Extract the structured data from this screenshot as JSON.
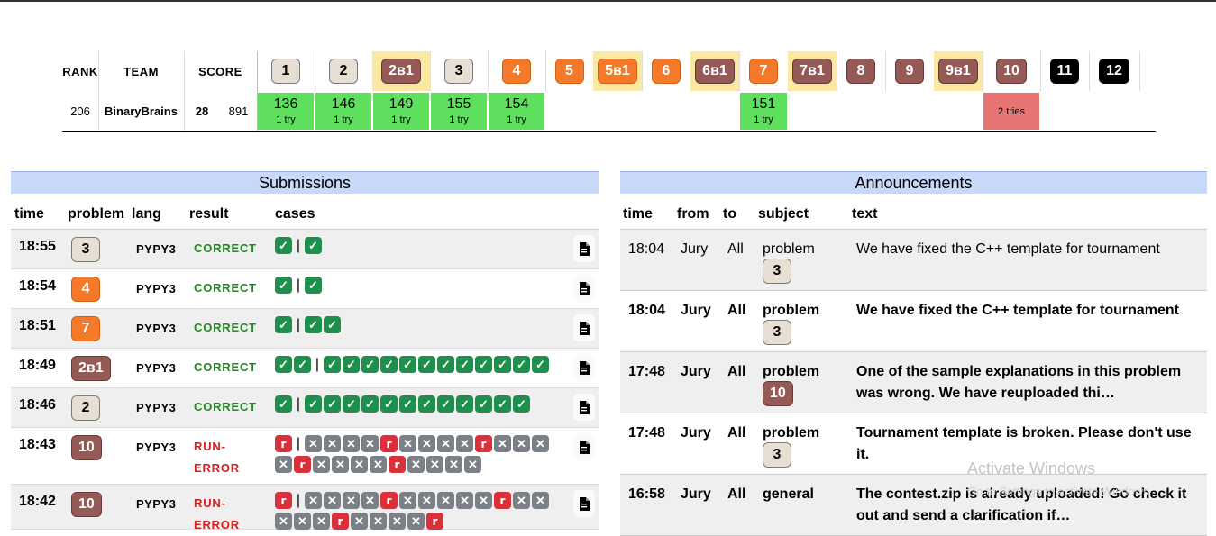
{
  "standings": {
    "headers": {
      "rank": "RANK",
      "team": "TEAM",
      "score": "SCORE"
    },
    "problems": [
      {
        "label": "1",
        "color": "tan",
        "hl": false
      },
      {
        "label": "2",
        "color": "tan",
        "hl": false
      },
      {
        "label": "2в1",
        "color": "brown",
        "hl": true
      },
      {
        "label": "3",
        "color": "tan",
        "hl": false
      },
      {
        "label": "4",
        "color": "orange",
        "hl": false
      },
      {
        "label": "5",
        "color": "orange",
        "hl": false
      },
      {
        "label": "5в1",
        "color": "orange",
        "hl": true
      },
      {
        "label": "6",
        "color": "orange",
        "hl": false
      },
      {
        "label": "6в1",
        "color": "brown",
        "hl": true
      },
      {
        "label": "7",
        "color": "orange",
        "hl": false
      },
      {
        "label": "7в1",
        "color": "brown",
        "hl": true
      },
      {
        "label": "8",
        "color": "brown",
        "hl": false
      },
      {
        "label": "9",
        "color": "brown",
        "hl": false
      },
      {
        "label": "9в1",
        "color": "brown",
        "hl": true
      },
      {
        "label": "10",
        "color": "brown",
        "hl": false
      },
      {
        "label": "11",
        "color": "black",
        "hl": false
      },
      {
        "label": "12",
        "color": "black",
        "hl": false
      }
    ],
    "row": {
      "rank": "206",
      "team": "BinaryBrains",
      "solved": "28",
      "penalty": "891",
      "cells": [
        {
          "time": "136",
          "tries": "1 try",
          "status": "ok"
        },
        {
          "time": "146",
          "tries": "1 try",
          "status": "ok"
        },
        {
          "time": "149",
          "tries": "1 try",
          "status": "ok"
        },
        {
          "time": "155",
          "tries": "1 try",
          "status": "ok"
        },
        {
          "time": "154",
          "tries": "1 try",
          "status": "ok"
        },
        null,
        null,
        null,
        null,
        {
          "time": "151",
          "tries": "1 try",
          "status": "ok"
        },
        null,
        null,
        null,
        null,
        {
          "time": "",
          "tries": "2 tries",
          "status": "bad"
        },
        null,
        null
      ]
    }
  },
  "submissions": {
    "title": "Submissions",
    "headers": {
      "time": "time",
      "problem": "problem",
      "lang": "lang",
      "result": "result",
      "cases": "cases"
    },
    "rows": [
      {
        "time": "18:55",
        "problem": "3",
        "pcolor": "tan",
        "lang": "PYPY3",
        "result": "CORRECT",
        "rtype": "correct",
        "cases": "o|o"
      },
      {
        "time": "18:54",
        "problem": "4",
        "pcolor": "orange",
        "lang": "PYPY3",
        "result": "CORRECT",
        "rtype": "correct",
        "cases": "o|o"
      },
      {
        "time": "18:51",
        "problem": "7",
        "pcolor": "orange",
        "lang": "PYPY3",
        "result": "CORRECT",
        "rtype": "correct",
        "cases": "o|oo"
      },
      {
        "time": "18:49",
        "problem": "2в1",
        "pcolor": "brown",
        "lang": "PYPY3",
        "result": "CORRECT",
        "rtype": "correct",
        "cases": "oo|oooooooooooo"
      },
      {
        "time": "18:46",
        "problem": "2",
        "pcolor": "tan",
        "lang": "PYPY3",
        "result": "CORRECT",
        "rtype": "correct",
        "cases": "o|oooooooooooo"
      },
      {
        "time": "18:43",
        "problem": "10",
        "pcolor": "brown",
        "lang": "PYPY3",
        "result": "RUN-ERROR",
        "rtype": "error",
        "cases": "r|xxxxrxxxxrxxxxrxxxxrxxxx"
      },
      {
        "time": "18:42",
        "problem": "10",
        "pcolor": "brown",
        "lang": "PYPY3",
        "result": "RUN-ERROR",
        "rtype": "error",
        "cases": "r|xxxxrxxxxxrxxxxxrxxxxr"
      }
    ],
    "icons": {
      "file": "file-icon",
      "check": "check-icon",
      "cross": "cross-icon",
      "runerror": "r"
    }
  },
  "announcements": {
    "title": "Announcements",
    "headers": {
      "time": "time",
      "from": "from",
      "to": "to",
      "subject": "subject",
      "text": "text"
    },
    "rows": [
      {
        "time": "18:04",
        "from": "Jury",
        "to": "All",
        "subject": "problem",
        "problem": "3",
        "pcolor": "tan",
        "text": "We have fixed the C++ template for tournament",
        "bold": false
      },
      {
        "time": "18:04",
        "from": "Jury",
        "to": "All",
        "subject": "problem",
        "problem": "3",
        "pcolor": "tan",
        "text": "We have fixed the C++ template for tournament",
        "bold": true
      },
      {
        "time": "17:48",
        "from": "Jury",
        "to": "All",
        "subject": "problem",
        "problem": "10",
        "pcolor": "brown",
        "text": "One of the sample explanations in this problem was wrong. We have reuploaded thi…",
        "bold": true
      },
      {
        "time": "17:48",
        "from": "Jury",
        "to": "All",
        "subject": "problem",
        "problem": "3",
        "pcolor": "tan",
        "text": "Tournament template is broken. Please don't use it.",
        "bold": true
      },
      {
        "time": "16:58",
        "from": "Jury",
        "to": "All",
        "subject": "general",
        "problem": "",
        "pcolor": "",
        "text": "The contest.zip is already uploaded! Go check it out and send a clarification if…",
        "bold": true
      }
    ]
  },
  "watermark": {
    "title": "Activate Windows",
    "subtitle": "Go to Settings to activate Windows."
  }
}
